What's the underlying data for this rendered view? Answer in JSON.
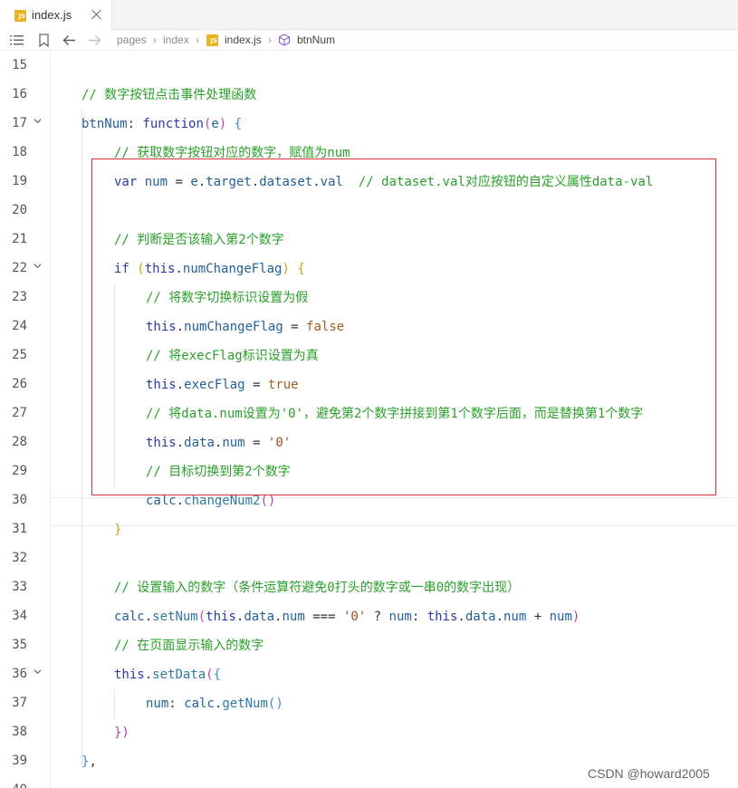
{
  "tab": {
    "icon": "js-file-icon",
    "label": "index.js"
  },
  "breadcrumb": [
    "pages",
    "index",
    "index.js",
    "btnNum"
  ],
  "lines": [
    {
      "n": "15",
      "indent": 0,
      "tokens": []
    },
    {
      "n": "16",
      "indent": 1,
      "tokens": [
        [
          "cm",
          "// 数字按钮点击事件处理函数"
        ]
      ]
    },
    {
      "n": "17",
      "indent": 1,
      "tokens": [
        [
          "vr",
          "btnNum"
        ],
        [
          "tx",
          ": "
        ],
        [
          "kw",
          "function"
        ],
        [
          "brk-p",
          "("
        ],
        [
          "vr",
          "e"
        ],
        [
          "brk-p",
          ")"
        ],
        [
          "tx",
          " "
        ],
        [
          "brk-b",
          "{"
        ]
      ]
    },
    {
      "n": "18",
      "indent": 2,
      "tokens": [
        [
          "cm",
          "// 获取数字按钮对应的数字，赋值为num"
        ]
      ]
    },
    {
      "n": "19",
      "indent": 2,
      "tokens": [
        [
          "kw",
          "var"
        ],
        [
          "tx",
          " "
        ],
        [
          "vr",
          "num"
        ],
        [
          "tx",
          " = "
        ],
        [
          "vr",
          "e"
        ],
        [
          "tx",
          "."
        ],
        [
          "vr",
          "target"
        ],
        [
          "tx",
          "."
        ],
        [
          "vr",
          "dataset"
        ],
        [
          "tx",
          "."
        ],
        [
          "vr",
          "val"
        ],
        [
          "tx",
          "  "
        ],
        [
          "cm",
          "// dataset.val对应按钮的自定义属性data-val"
        ]
      ]
    },
    {
      "n": "20",
      "indent": 0,
      "tokens": []
    },
    {
      "n": "21",
      "indent": 2,
      "tokens": [
        [
          "cm",
          "// 判断是否该输入第2个数字"
        ]
      ]
    },
    {
      "n": "22",
      "indent": 2,
      "tokens": [
        [
          "kw",
          "if"
        ],
        [
          "tx",
          " "
        ],
        [
          "brk-y",
          "("
        ],
        [
          "kw",
          "this"
        ],
        [
          "tx",
          "."
        ],
        [
          "vr",
          "numChangeFlag"
        ],
        [
          "brk-y",
          ")"
        ],
        [
          "tx",
          " "
        ],
        [
          "brk-y",
          "{"
        ]
      ]
    },
    {
      "n": "23",
      "indent": 3,
      "tokens": [
        [
          "cm",
          "// 将数字切换标识设置为假"
        ]
      ]
    },
    {
      "n": "24",
      "indent": 3,
      "tokens": [
        [
          "kw",
          "this"
        ],
        [
          "tx",
          "."
        ],
        [
          "vr",
          "numChangeFlag"
        ],
        [
          "tx",
          " = "
        ],
        [
          "bool",
          "false"
        ]
      ]
    },
    {
      "n": "25",
      "indent": 3,
      "tokens": [
        [
          "cm",
          "// 将execFlag标识设置为真"
        ]
      ]
    },
    {
      "n": "26",
      "indent": 3,
      "tokens": [
        [
          "kw",
          "this"
        ],
        [
          "tx",
          "."
        ],
        [
          "vr",
          "execFlag"
        ],
        [
          "tx",
          " = "
        ],
        [
          "bool",
          "true"
        ]
      ]
    },
    {
      "n": "27",
      "indent": 3,
      "tokens": [
        [
          "cm",
          "// 将data.num设置为'0'，避免第2个数字拼接到第1个数字后面，而是替换第1个数字"
        ]
      ]
    },
    {
      "n": "28",
      "indent": 3,
      "tokens": [
        [
          "kw",
          "this"
        ],
        [
          "tx",
          "."
        ],
        [
          "vr",
          "data"
        ],
        [
          "tx",
          "."
        ],
        [
          "vr",
          "num"
        ],
        [
          "tx",
          " = "
        ],
        [
          "str",
          "'0'"
        ]
      ]
    },
    {
      "n": "29",
      "indent": 3,
      "tokens": [
        [
          "cm",
          "// 目标切换到第2个数字"
        ]
      ]
    },
    {
      "n": "30",
      "indent": 3,
      "tokens": [
        [
          "vr",
          "calc"
        ],
        [
          "tx",
          "."
        ],
        [
          "fn",
          "changeNum2"
        ],
        [
          "brk-p",
          "()"
        ]
      ]
    },
    {
      "n": "31",
      "indent": 2,
      "tokens": [
        [
          "brk-y",
          "}"
        ]
      ]
    },
    {
      "n": "32",
      "indent": 0,
      "tokens": []
    },
    {
      "n": "33",
      "indent": 2,
      "tokens": [
        [
          "cm",
          "// 设置输入的数字（条件运算符避免0打头的数字或一串0的数字出现）"
        ]
      ]
    },
    {
      "n": "34",
      "indent": 2,
      "tokens": [
        [
          "vr",
          "calc"
        ],
        [
          "tx",
          "."
        ],
        [
          "fn",
          "setNum"
        ],
        [
          "brk-p",
          "("
        ],
        [
          "kw",
          "this"
        ],
        [
          "tx",
          "."
        ],
        [
          "vr",
          "data"
        ],
        [
          "tx",
          "."
        ],
        [
          "vr",
          "num"
        ],
        [
          "tx",
          " === "
        ],
        [
          "str",
          "'0'"
        ],
        [
          "tx",
          " ? "
        ],
        [
          "vr",
          "num"
        ],
        [
          "tx",
          ": "
        ],
        [
          "kw",
          "this"
        ],
        [
          "tx",
          "."
        ],
        [
          "vr",
          "data"
        ],
        [
          "tx",
          "."
        ],
        [
          "vr",
          "num"
        ],
        [
          "tx",
          " + "
        ],
        [
          "vr",
          "num"
        ],
        [
          "brk-p",
          ")"
        ]
      ]
    },
    {
      "n": "35",
      "indent": 2,
      "tokens": [
        [
          "cm",
          "// 在页面显示输入的数字"
        ]
      ]
    },
    {
      "n": "36",
      "indent": 2,
      "tokens": [
        [
          "kw",
          "this"
        ],
        [
          "tx",
          "."
        ],
        [
          "fn",
          "setData"
        ],
        [
          "brk-p",
          "("
        ],
        [
          "brk-b",
          "{"
        ]
      ]
    },
    {
      "n": "37",
      "indent": 3,
      "tokens": [
        [
          "vr",
          "num"
        ],
        [
          "tx",
          ": "
        ],
        [
          "vr",
          "calc"
        ],
        [
          "tx",
          "."
        ],
        [
          "fn",
          "getNum"
        ],
        [
          "brk-b",
          "()"
        ]
      ]
    },
    {
      "n": "38",
      "indent": 2,
      "tokens": [
        [
          "brk-p",
          "})"
        ]
      ]
    },
    {
      "n": "39",
      "indent": 1,
      "tokens": [
        [
          "brk-b",
          "}"
        ],
        [
          "tx",
          ","
        ]
      ]
    },
    {
      "n": "40",
      "indent": 0,
      "tokens": []
    }
  ],
  "folded_lines": [
    "17",
    "22",
    "36"
  ],
  "current_line": "31",
  "watermark": "CSDN @howard2005"
}
